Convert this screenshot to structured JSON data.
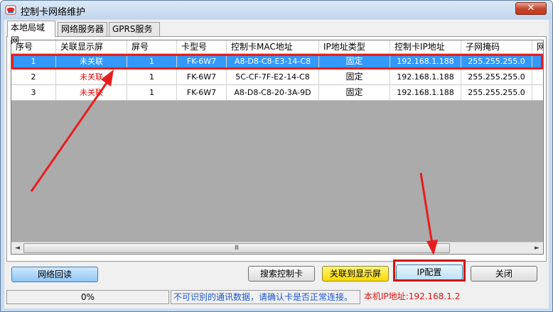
{
  "window": {
    "title": "控制卡网络维护",
    "close_glyph": "✕"
  },
  "tabs": [
    {
      "label": "本地局域网"
    },
    {
      "label": "网络服务器"
    },
    {
      "label": "GPRS服务器"
    }
  ],
  "table": {
    "columns": [
      "序号",
      "关联显示屏",
      "屏号",
      "卡型号",
      "控制卡MAC地址",
      "IP地址类型",
      "控制卡IP地址",
      "子网掩码",
      "网"
    ],
    "rows": [
      [
        "1",
        "未关联",
        "1",
        "FK-6W7",
        "A8-D8-C8-E3-14-C8",
        "固定",
        "192.168.1.188",
        "255.255.255.0"
      ],
      [
        "2",
        "未关联",
        "1",
        "FK-6W7",
        "5C-CF-7F-E2-14-C8",
        "固定",
        "192.168.1.188",
        "255.255.255.0"
      ],
      [
        "3",
        "未关联",
        "1",
        "FK-6W7",
        "A8-D8-C8-20-3A-9D",
        "固定",
        "192.168.1.188",
        "255.255.255.0"
      ]
    ],
    "selected_row": 1,
    "scroll_left": "◄",
    "scroll_right": "►",
    "scroll_grip": "Ⅲ"
  },
  "buttons": {
    "network_readback": "网络回读",
    "search_card": "搜索控制卡",
    "link_to_screen": "关联到显示屏",
    "ip_config": "IP配置",
    "close": "关闭"
  },
  "status": {
    "progress": "0%",
    "message": "不可识别的通讯数据，请确认卡是否正常连接。",
    "local_ip": "本机IP地址:192.168.1.2"
  },
  "colors": {
    "selection": "#3399ff",
    "annotation_red": "#e81d1d",
    "unlinked_text": "#e01010",
    "status_message": "#1a55d0"
  }
}
